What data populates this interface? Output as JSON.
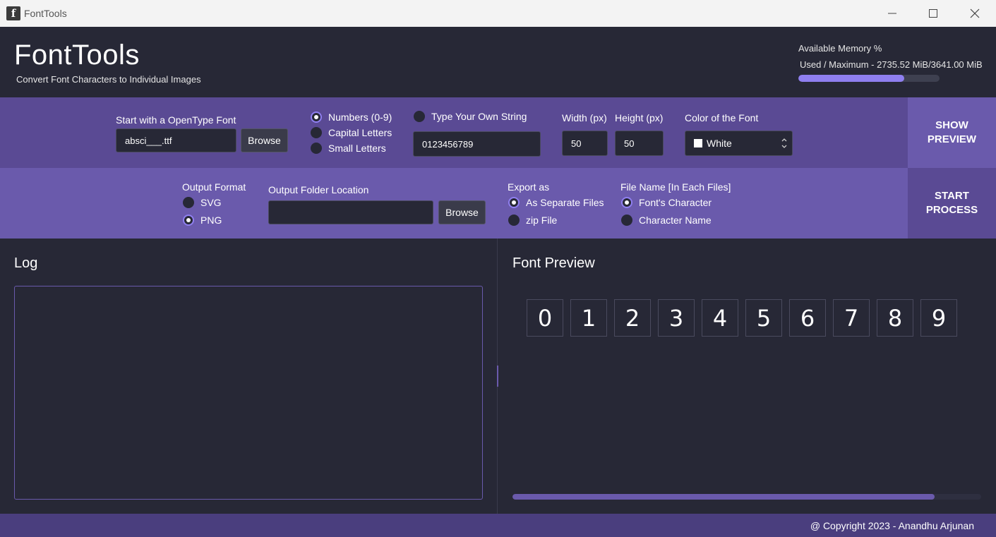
{
  "window": {
    "title": "FontTools",
    "app_icon_letter": "f"
  },
  "header": {
    "app_name": "FontTools",
    "subtitle": "Convert Font Characters to Individual Images",
    "memory_title": "Available Memory %",
    "memory_text": "Used / Maximum - 2735.52 MiB/3641.00 MiB",
    "memory_used_fraction": 0.75
  },
  "row1": {
    "font_label": "Start with a OpenType Font",
    "font_value": "absci___.ttf",
    "browse_label": "Browse",
    "char_options": [
      {
        "label": "Numbers (0-9)",
        "selected": true
      },
      {
        "label": "Capital Letters",
        "selected": false
      },
      {
        "label": "Small Letters",
        "selected": false
      }
    ],
    "own_string_label": "Type Your Own String",
    "own_string_value": "0123456789",
    "width_label": "Width (px)",
    "width_value": "50",
    "height_label": "Height (px)",
    "height_value": "50",
    "color_label": "Color of the Font",
    "color_value": "White",
    "color_swatch": "#ffffff",
    "show_preview_label": "SHOW PREVIEW"
  },
  "row2": {
    "output_format_label": "Output Format",
    "format_options": [
      {
        "label": "SVG",
        "selected": false
      },
      {
        "label": "PNG",
        "selected": true
      }
    ],
    "folder_label": "Output Folder Location",
    "folder_value": "",
    "browse_label": "Browse",
    "export_label": "Export as",
    "export_options": [
      {
        "label": "As Separate Files",
        "selected": true
      },
      {
        "label": "zip File",
        "selected": false
      }
    ],
    "filename_label": "File Name [In Each Files]",
    "filename_options": [
      {
        "label": "Font's Character",
        "selected": true
      },
      {
        "label": "Character Name",
        "selected": false
      }
    ],
    "start_process_label": "START PROCESS"
  },
  "log": {
    "title": "Log",
    "content": ""
  },
  "preview": {
    "title": "Font Preview",
    "glyphs": [
      "0",
      "1",
      "2",
      "3",
      "4",
      "5",
      "6",
      "7",
      "8",
      "9"
    ],
    "scroll_fraction": 0.9
  },
  "footer": {
    "copyright": "@ Copyright 2023 - Anandhu Arjunan"
  },
  "colors": {
    "accent": "#8f7ff0",
    "row1_bg": "#5a4a94",
    "row2_bg": "#6a5aac",
    "app_bg": "#272836"
  }
}
